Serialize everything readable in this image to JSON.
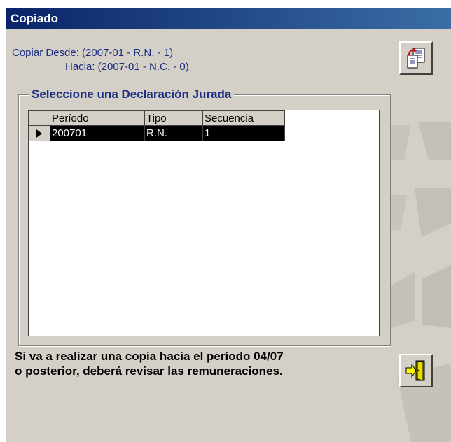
{
  "window": {
    "title": "Copiado"
  },
  "copy_info": {
    "from": "Copiar Desde: (2007-01 - R.N. - 1)",
    "to": "Hacia: (2007-01 - N.C. - 0)"
  },
  "group": {
    "legend": "Seleccione una Declaración Jurada",
    "columns": [
      "Período",
      "Tipo",
      "Secuencia"
    ],
    "rows": [
      {
        "periodo": "200701",
        "tipo": "R.N.",
        "secuencia": "1",
        "selected": true
      }
    ]
  },
  "message": {
    "line1": "Si va a realizar una copia hacia el período 04/07",
    "line2": "o posterior, deberá revisar las remuneraciones."
  },
  "buttons": {
    "copy_icon": "copy-document-icon",
    "exit_icon": "exit-door-icon"
  },
  "colors": {
    "title_bar": "#0a246a",
    "label_text": "#1c2e82",
    "selected_row": "#000000",
    "window_bg": "#d4d0c8"
  }
}
